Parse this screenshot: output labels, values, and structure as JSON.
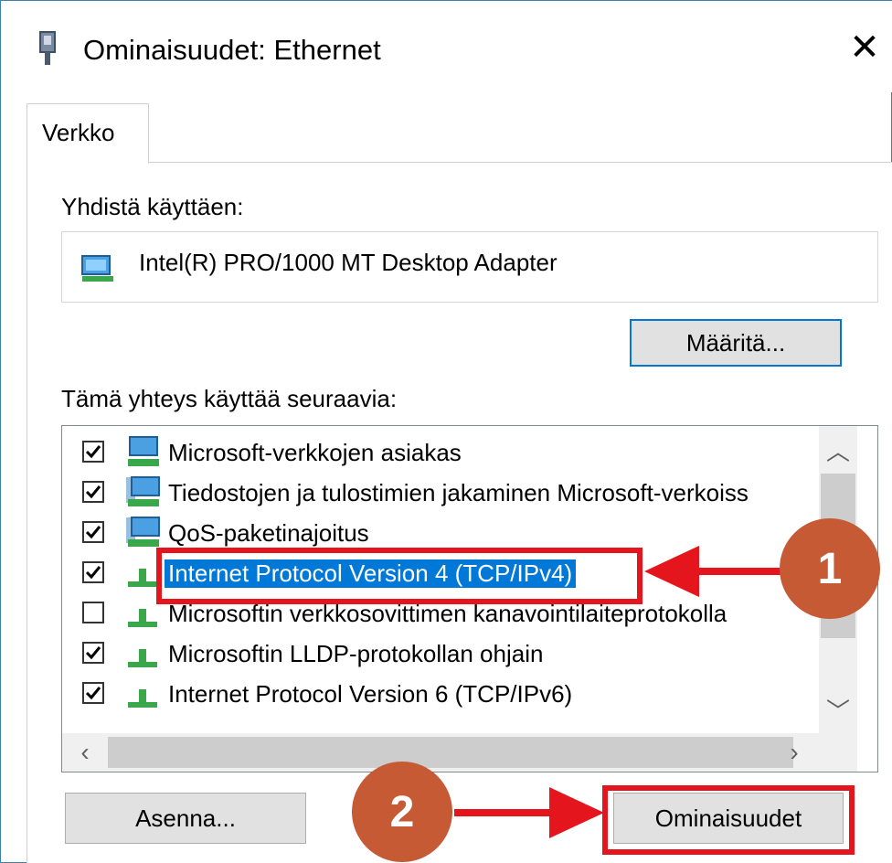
{
  "window": {
    "title": "Ominaisuudet: Ethernet",
    "close_glyph": "✕"
  },
  "tabs": [
    {
      "label": "Verkko"
    }
  ],
  "connect_using": {
    "label": "Yhdistä käyttäen:",
    "adapter": "Intel(R) PRO/1000 MT Desktop Adapter",
    "configure_button": "Määritä..."
  },
  "components": {
    "label": "Tämä yhteys käyttää seuraavia:",
    "items": [
      {
        "label": "Microsoft-verkkojen asiakas",
        "checked": true,
        "icon": "network-client-icon",
        "selected": false
      },
      {
        "label": "Tiedostojen ja tulostimien jakaminen Microsoft-verkoiss",
        "checked": true,
        "icon": "network-service-icon",
        "selected": false
      },
      {
        "label": "QoS-paketinajoitus",
        "checked": true,
        "icon": "network-service-icon",
        "selected": false
      },
      {
        "label": "Internet Protocol Version 4 (TCP/IPv4)",
        "checked": true,
        "icon": "protocol-icon",
        "selected": true
      },
      {
        "label": "Microsoftin verkkosovittimen kanavointilaiteprotokolla",
        "checked": false,
        "icon": "protocol-icon",
        "selected": false
      },
      {
        "label": "Microsoftin LLDP-protokollan ohjain",
        "checked": true,
        "icon": "protocol-icon",
        "selected": false
      },
      {
        "label": "Internet Protocol Version 6 (TCP/IPv6)",
        "checked": true,
        "icon": "protocol-icon",
        "selected": false
      }
    ]
  },
  "buttons": {
    "install": "Asenna...",
    "properties": "Ominaisuudet"
  },
  "annotations": {
    "step1": "1",
    "step2": "2",
    "highlight_color": "#e5151d",
    "badge_color": "#c55a35"
  },
  "colors": {
    "selection": "#0078d7",
    "window_border": "#3c7fb1"
  }
}
